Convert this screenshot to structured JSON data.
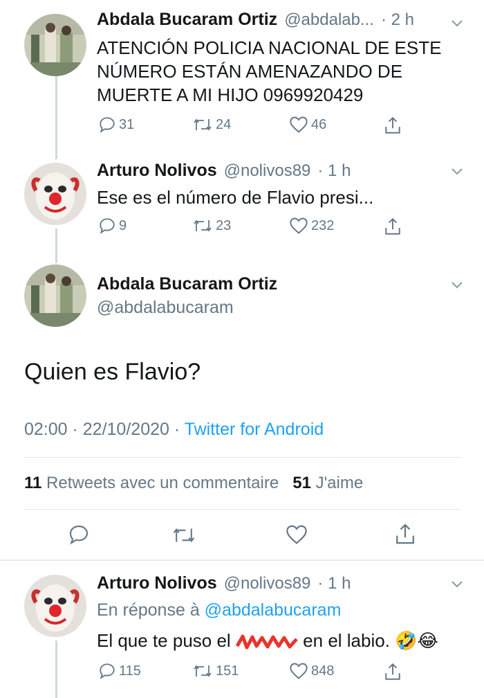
{
  "tweets": [
    {
      "name": "Abdala Bucaram Ortiz",
      "handle": "@abdalab...",
      "time": "· 2 h",
      "text_lines": [
        "ATENCIÓN POLICIA NACIONAL  DE ESTE",
        "NÚMERO ESTÁN AMENAZANDO DE",
        "MUERTE A MI HIJO 0969920429"
      ],
      "replies": "31",
      "retweets": "24",
      "likes": "46"
    },
    {
      "name": "Arturo Nolivos",
      "handle": "@nolivos89",
      "time": "· 1 h",
      "text": "Ese es el número de Flavio presi...",
      "replies": "9",
      "retweets": "23",
      "likes": "232"
    }
  ],
  "main": {
    "name": "Abdala Bucaram Ortiz",
    "handle": "@abdalabucaram",
    "text": "Quien es Flavio?",
    "datetime": "02:00 · 22/10/2020 ·",
    "source": "Twitter for Android",
    "retweet_count": "11",
    "retweet_label": "Retweets avec un commentaire",
    "like_count": "51",
    "like_label": "J'aime"
  },
  "reply": {
    "name": "Arturo Nolivos",
    "handle": "@nolivos89",
    "time": "· 1 h",
    "in_reply_prefix": "En réponse à",
    "in_reply_handle": "@abdalabucaram",
    "text_before": "El que te puso el",
    "text_after": "en el labio.",
    "emoji": "🤣😂",
    "replies": "115",
    "retweets": "151",
    "likes": "848"
  },
  "colors": {
    "muted": "#657786",
    "link": "#1da1f2",
    "line": "#cfd9de"
  }
}
